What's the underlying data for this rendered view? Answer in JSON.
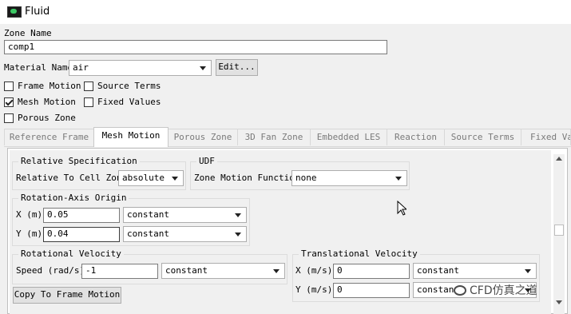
{
  "window": {
    "title": "Fluid",
    "app_icon": "fluent-icon"
  },
  "zone_name": {
    "label": "Zone Name",
    "value": "comp1"
  },
  "material": {
    "label": "Material Name",
    "value": "air",
    "edit_label": "Edit..."
  },
  "options": {
    "frame_motion": {
      "label": "Frame Motion",
      "checked": false
    },
    "source_terms": {
      "label": "Source Terms",
      "checked": false
    },
    "mesh_motion": {
      "label": "Mesh Motion",
      "checked": true
    },
    "fixed_values": {
      "label": "Fixed Values",
      "checked": false
    },
    "porous_zone": {
      "label": "Porous Zone",
      "checked": false
    }
  },
  "tabs": [
    {
      "label": "Reference Frame",
      "active": false
    },
    {
      "label": "Mesh Motion",
      "active": true
    },
    {
      "label": "Porous Zone",
      "active": false
    },
    {
      "label": "3D Fan Zone",
      "active": false
    },
    {
      "label": "Embedded LES",
      "active": false
    },
    {
      "label": "Reaction",
      "active": false
    },
    {
      "label": "Source Terms",
      "active": false
    },
    {
      "label": "Fixed Val",
      "active": false
    }
  ],
  "relative_spec": {
    "title": "Relative Specification",
    "label": "Relative To Cell Zone",
    "value": "absolute"
  },
  "udf": {
    "title": "UDF",
    "label": "Zone Motion Function",
    "value": "none"
  },
  "rotation_axis_origin": {
    "title": "Rotation-Axis Origin",
    "x": {
      "label": "X (m)",
      "value": "0.05",
      "method": "constant"
    },
    "y": {
      "label": "Y (m)",
      "value": "0.04",
      "method": "constant"
    }
  },
  "rotational_velocity": {
    "title": "Rotational Velocity",
    "speed": {
      "label": "Speed (rad/s)",
      "value": "-1",
      "method": "constant"
    },
    "copy_label": "Copy To Frame Motion"
  },
  "translational_velocity": {
    "title": "Translational Velocity",
    "x": {
      "label": "X (m/s)",
      "value": "0",
      "method": "constant"
    },
    "y": {
      "label": "Y (m/s)",
      "value": "0",
      "method": "constan"
    }
  },
  "watermark": {
    "text": "CFD仿真之道"
  }
}
